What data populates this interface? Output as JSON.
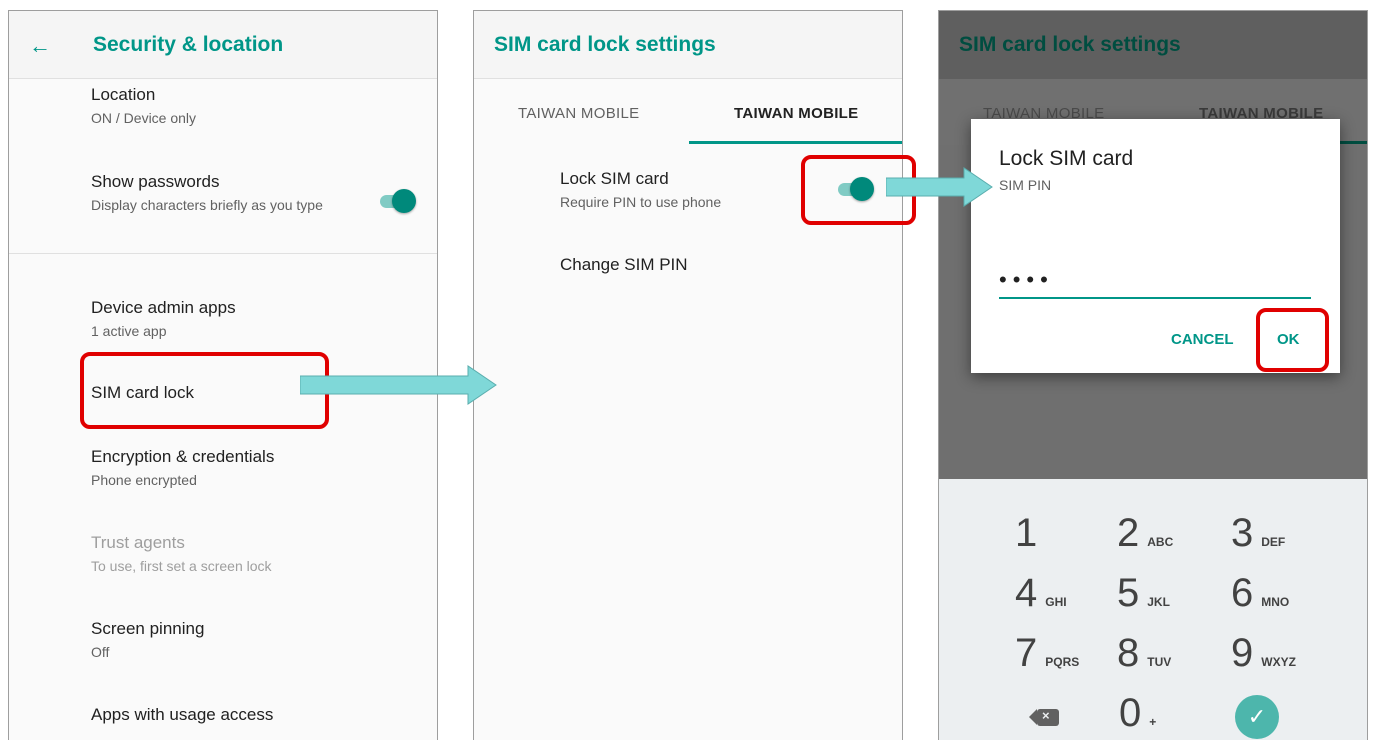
{
  "panel1": {
    "title": "Security & location",
    "back_icon": "←",
    "items": [
      {
        "title": "Location",
        "subtitle": "ON / Device only"
      },
      {
        "title": "Show passwords",
        "subtitle": "Display characters briefly as you type"
      },
      {
        "title": "Device admin apps",
        "subtitle": "1 active app"
      },
      {
        "title": "SIM card lock"
      },
      {
        "title": "Encryption & credentials",
        "subtitle": "Phone encrypted"
      },
      {
        "title": "Trust agents",
        "subtitle": "To use, first set a screen lock"
      },
      {
        "title": "Screen pinning",
        "subtitle": "Off"
      },
      {
        "title": "Apps with usage access"
      }
    ],
    "show_passwords_on": true
  },
  "panel2": {
    "title": "SIM card lock settings",
    "tabs": [
      "TAIWAN MOBILE",
      "TAIWAN MOBILE"
    ],
    "lock_sim": {
      "title": "Lock SIM card",
      "subtitle": "Require PIN to use phone",
      "on": true
    },
    "change_pin": "Change SIM PIN"
  },
  "panel3": {
    "title": "SIM card lock settings",
    "tabs": [
      "TAIWAN MOBILE",
      "TAIWAN MOBILE"
    ],
    "dialog": {
      "title": "Lock SIM card",
      "subtitle": "SIM PIN",
      "pin_value": "••••",
      "cancel": "CANCEL",
      "ok": "OK"
    },
    "keys": [
      {
        "d": "1",
        "l": ""
      },
      {
        "d": "2",
        "l": "ABC"
      },
      {
        "d": "3",
        "l": "DEF"
      },
      {
        "d": "4",
        "l": "GHI"
      },
      {
        "d": "5",
        "l": "JKL"
      },
      {
        "d": "6",
        "l": "MNO"
      },
      {
        "d": "7",
        "l": "PQRS"
      },
      {
        "d": "8",
        "l": "TUV"
      },
      {
        "d": "9",
        "l": "WXYZ"
      }
    ],
    "zero": "0",
    "zero_sub": "+",
    "backspace_glyph": "×",
    "ok_glyph": "✓"
  },
  "colors": {
    "accent": "#009688",
    "highlight": "#e00000",
    "arrow": "#7fd8d8"
  }
}
